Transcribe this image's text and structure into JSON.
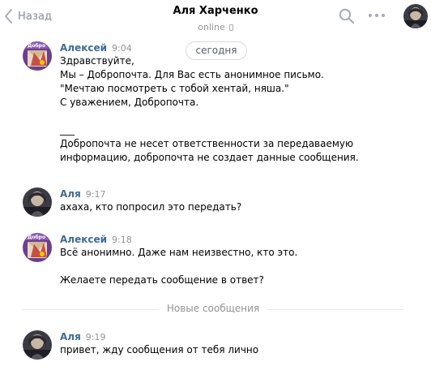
{
  "header": {
    "back_label": "Назад",
    "title": "Аля Харченко",
    "status": "online",
    "icons": {
      "search": "search-icon",
      "more": "more-icon",
      "phone": "mobile-phone-icon"
    }
  },
  "date_pill": "сегодня",
  "messages": [
    {
      "author": "Алексей",
      "time": "9:04",
      "text": "Здравствуйте,\nМы – Добропочта. Для Вас есть анонимное письмо.\n\"Мечтаю посмотреть с тобой хентай, няша.\"\nС уважением, Добропочта.\n\n___\nДобропочта не несет ответственности за передаваемую\nинформацию, добропочта не создает данные сообщения."
    },
    {
      "author": "Аля",
      "time": "9:17",
      "text": "ахаха, кто попросил это передать?"
    },
    {
      "author": "Алексей",
      "time": "9:18",
      "text": "Всё анонимно. Даже нам неизвестно, кто это.\n\nЖелаете передать сообщение в ответ?"
    },
    {
      "author": "Аля",
      "time": "9:19",
      "text": "привет, жду сообщения от тебя лично"
    }
  ],
  "new_messages_divider": "Новые сообщения",
  "colors": {
    "author": "#3f6a98",
    "muted": "#939393",
    "back": "#828a99",
    "divider_line": "#e7e8ec"
  }
}
